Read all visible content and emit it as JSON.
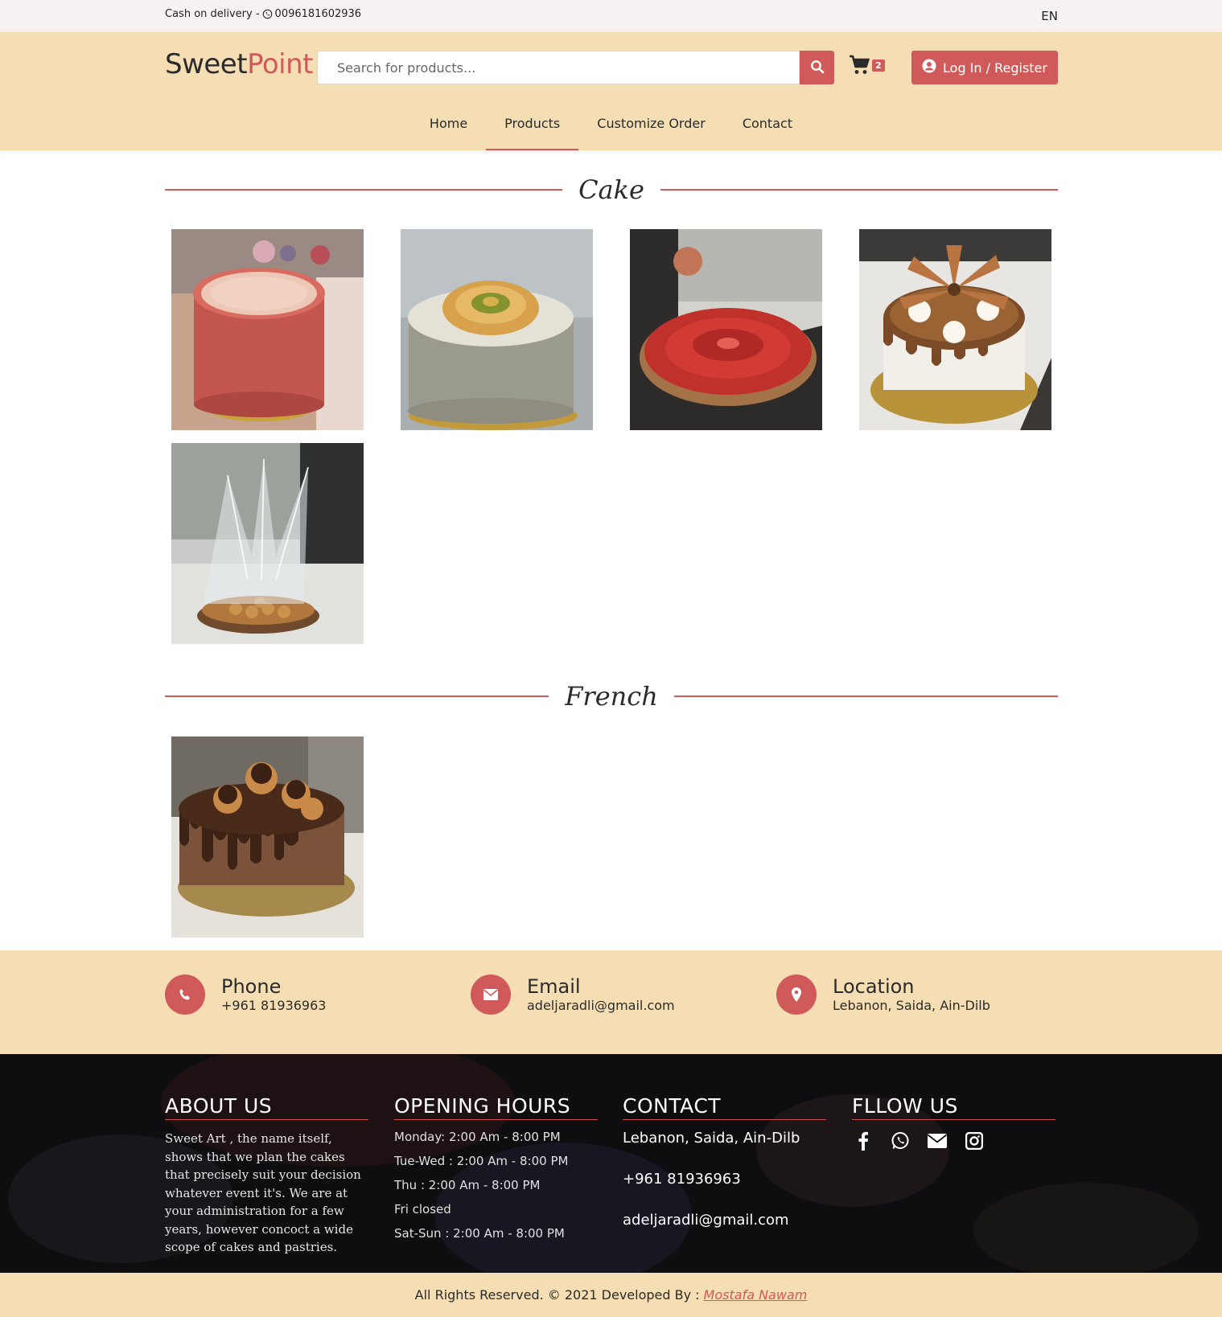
{
  "topbar": {
    "info_prefix": "Cash on delivery - ",
    "phone": "0096181602936",
    "language": "EN"
  },
  "header": {
    "logo_part1": "Sweet",
    "logo_part2": "Point",
    "search_placeholder": "Search for products...",
    "cart_count": "2",
    "login_label": "Log In / Register"
  },
  "nav": {
    "items": [
      {
        "label": "Home"
      },
      {
        "label": "Products"
      },
      {
        "label": "Customize Order"
      },
      {
        "label": "Contact"
      }
    ],
    "active": "Products"
  },
  "sections": {
    "cake_title": "Cake",
    "french_title": "French"
  },
  "contact_strip": {
    "phone_label": "Phone",
    "phone_value": "+961 81936963",
    "email_label": "Email",
    "email_value": "adeljaradli@gmail.com",
    "location_label": "Location",
    "location_value": "Lebanon, Saida, Ain-Dilb"
  },
  "footer": {
    "about_title": "ABOUT US",
    "about_text": "Sweet Art , the name itself, shows that we plan the cakes that precisely suit your decision whatever event it's. We are at your administration for a few years, however concoct a wide scope of cakes and pastries.",
    "hours_title": "OPENING HOURS",
    "hours": [
      "Monday: 2:00 Am - 8:00 PM",
      "Tue-Wed : 2:00 Am - 8:00 PM",
      "Thu : 2:00 Am - 8:00 PM",
      "Fri closed",
      "Sat-Sun : 2:00 Am - 8:00 PM"
    ],
    "contact_title": "CONTACT",
    "contact_location": "Lebanon, Saida, Ain-Dilb",
    "contact_phone": "+961 81936963",
    "contact_email": "adeljaradli@gmail.com",
    "follow_title": "FLLOW US",
    "social_icons": [
      "facebook-icon",
      "whatsapp-icon",
      "envelope-icon",
      "instagram-icon"
    ]
  },
  "copyright": {
    "text": "All Rights Reserved. © 2021 Developed By :",
    "developer": "Mostafa Nawam"
  },
  "colors": {
    "accent": "#d05a5a",
    "header_bg": "#f5deb3",
    "topbar_bg": "#f6f2f2",
    "footer_bg": "#0f0f11"
  }
}
